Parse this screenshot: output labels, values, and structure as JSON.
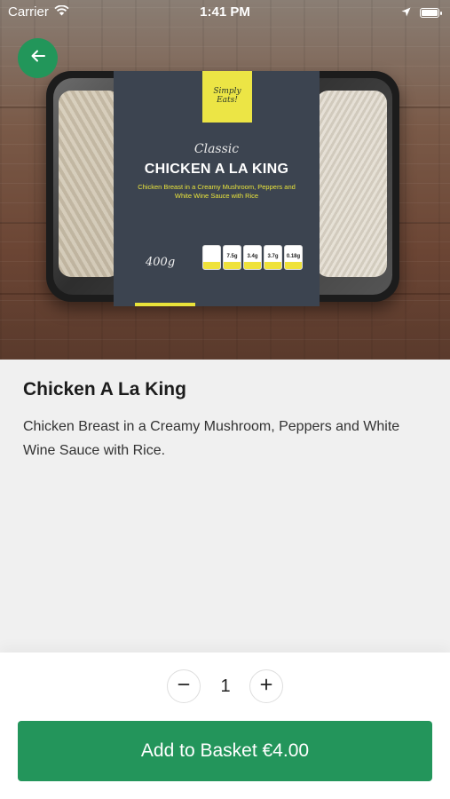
{
  "status_bar": {
    "carrier": "Carrier",
    "time": "1:41 PM"
  },
  "hero": {
    "product_image": "ready-meal-tray-chicken-a-la-king",
    "package": {
      "brand": "Simply Eats!",
      "script_label": "Classic",
      "title": "CHICKEN A LA KING",
      "subtitle": "Chicken Breast in a Creamy Mushroom, Peppers and White Wine Sauce with Rice",
      "weight": "400g",
      "nutrition": [
        "7.5g",
        "3.4g",
        "3.7g",
        "0.18g"
      ]
    }
  },
  "product": {
    "name": "Chicken A La King",
    "description": "Chicken Breast in a Creamy Mushroom, Peppers and White Wine Sauce with Rice."
  },
  "cart": {
    "quantity": "1",
    "add_label": "Add to Basket €4.00"
  },
  "colors": {
    "accent_green": "#22965a",
    "background": "#f0f0f0",
    "package_slate": "#3c4450",
    "package_yellow": "#ece545"
  },
  "icons": {
    "back": "arrow-left-icon",
    "minus": "minus-icon",
    "plus": "plus-icon",
    "wifi": "wifi-icon",
    "location": "location-arrow-icon",
    "battery": "battery-icon"
  }
}
